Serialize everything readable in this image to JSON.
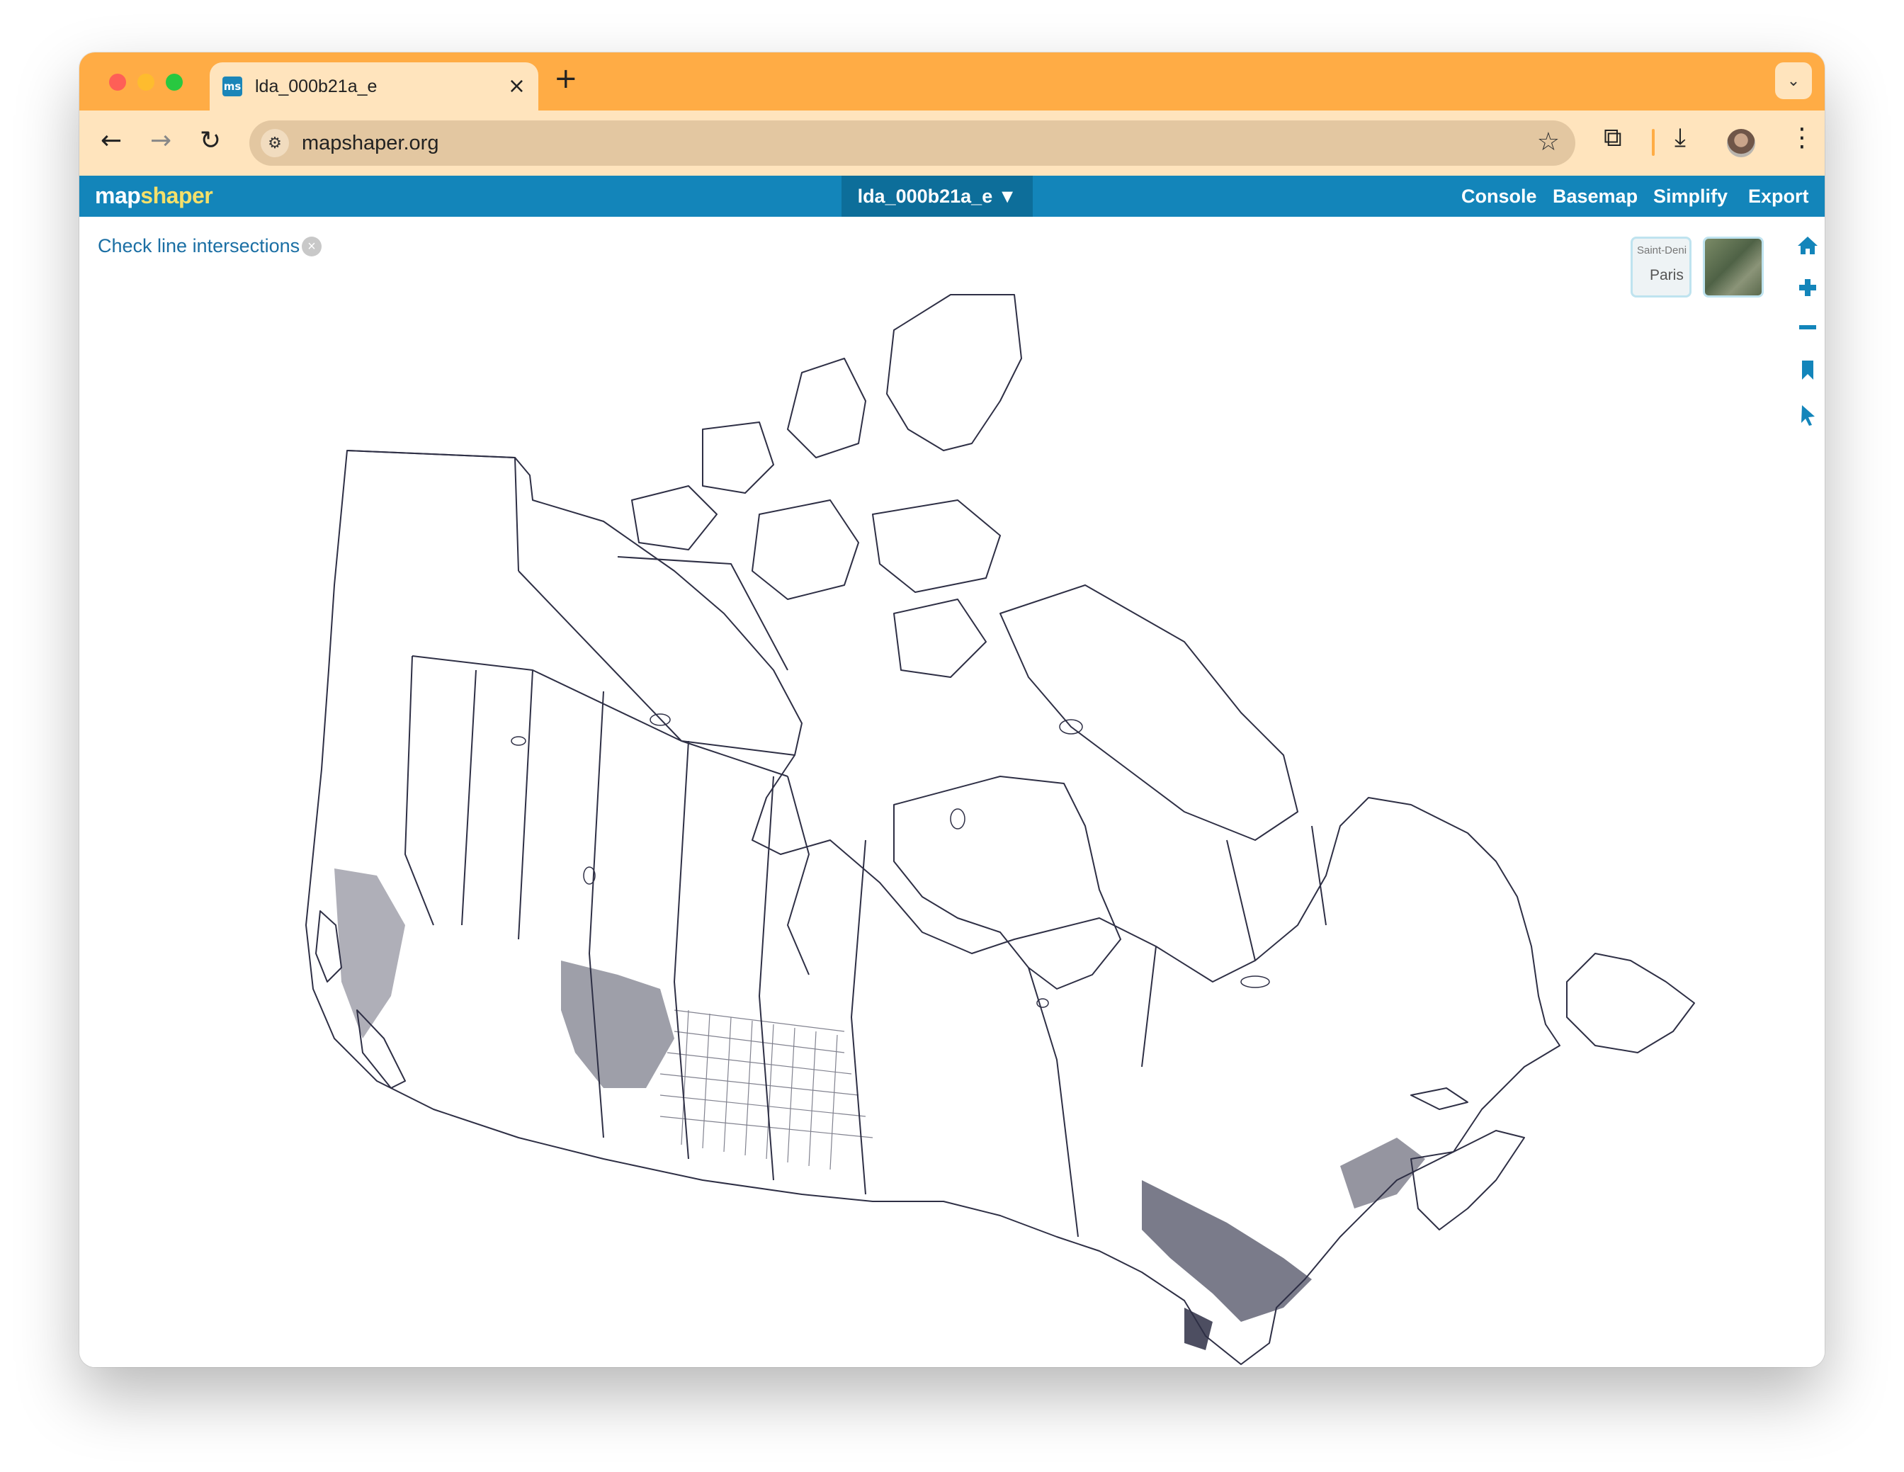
{
  "browser": {
    "tab_title": "lda_000b21a_e",
    "tab_favicon_text": "ms",
    "url": "mapshaper.org"
  },
  "app": {
    "logo_part1": "map",
    "logo_part2": "shaper",
    "layer_name": "lda_000b21a_e ▼",
    "menu": [
      "Console",
      "Basemap",
      "Simplify",
      "Export"
    ]
  },
  "map": {
    "intersection_link": "Check line intersections",
    "basemap_thumb_label_top": "Saint-Deni",
    "basemap_thumb_label_city": "Paris",
    "stroke_color": "#2e2f45"
  },
  "colors": {
    "tab_strip": "#ffac45",
    "toolbar": "#ffe4bd",
    "app_bar": "#1385ba",
    "link": "#1b6fa4"
  }
}
